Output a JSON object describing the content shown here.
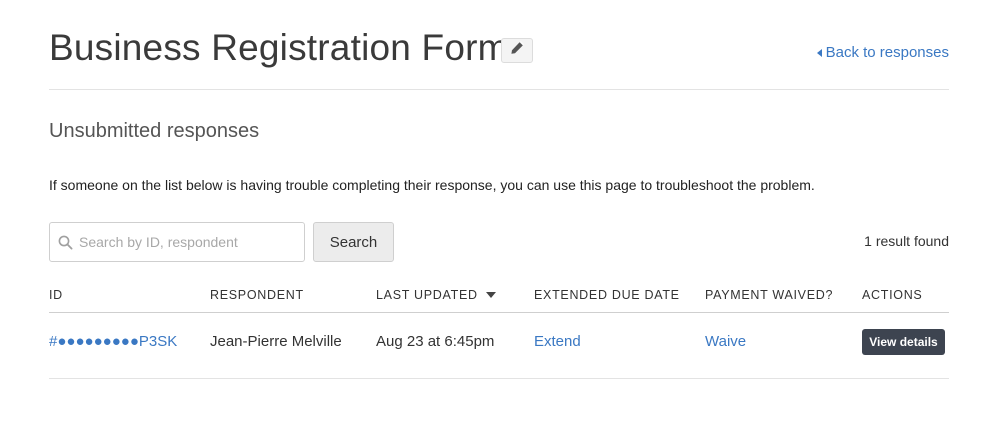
{
  "header": {
    "title": "Business Registration Form",
    "back_label": "Back to responses"
  },
  "section": {
    "title": "Unsubmitted responses",
    "intro": "If someone on the list below is having trouble completing their response, you can use this page to troubleshoot the problem."
  },
  "search": {
    "placeholder": "Search by ID, respondent",
    "value": "",
    "button_label": "Search",
    "result_count": "1 result found"
  },
  "table": {
    "columns": [
      "ID",
      "RESPONDENT",
      "LAST UPDATED",
      "EXTENDED DUE DATE",
      "PAYMENT WAIVED?",
      "ACTIONS"
    ],
    "sorted_column": "LAST UPDATED",
    "rows": [
      {
        "id": "#●●●●●●●●●P3SK",
        "respondent": "Jean-Pierre Melville",
        "last_updated": "Aug 23 at 6:45pm",
        "extend": "Extend",
        "waive": "Waive",
        "action": "View details"
      }
    ]
  },
  "colors": {
    "link": "#3a78c3",
    "action_button_bg": "#3d4450",
    "divider": "#e3e3e3"
  },
  "icons": {
    "edit": "pencil-icon",
    "back": "caret-left-icon",
    "search": "search-icon",
    "sort": "caret-down-icon"
  }
}
